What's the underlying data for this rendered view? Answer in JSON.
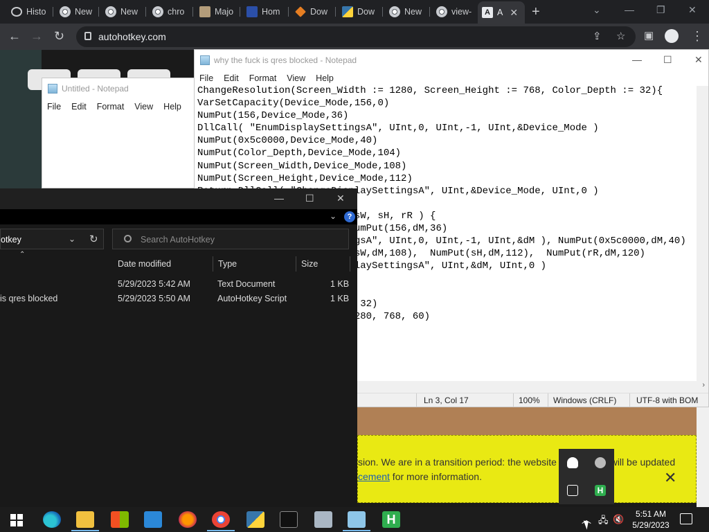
{
  "browser": {
    "tabs": [
      {
        "label": "Histo",
        "icon": "history-icon"
      },
      {
        "label": "New",
        "icon": "chrome-icon"
      },
      {
        "label": "New",
        "icon": "chrome-icon"
      },
      {
        "label": "chro",
        "icon": "chrome-icon"
      },
      {
        "label": "Majo",
        "icon": "site-icon"
      },
      {
        "label": "Hom",
        "icon": "site-icon"
      },
      {
        "label": "Dow",
        "icon": "site-icon"
      },
      {
        "label": "Dow",
        "icon": "python-icon"
      },
      {
        "label": "New",
        "icon": "chrome-icon"
      },
      {
        "label": "view-",
        "icon": "chrome-icon"
      },
      {
        "label": "A",
        "icon": "autohotkey-icon",
        "active": true
      }
    ],
    "url": "autohotkey.com"
  },
  "notepad_bg": {
    "title": "Untitled - Notepad",
    "menu": [
      "File",
      "Edit",
      "Format",
      "View",
      "Help"
    ]
  },
  "notepad_main": {
    "title": "why the fuck is qres blocked - Notepad",
    "menu": [
      "File",
      "Edit",
      "Format",
      "View",
      "Help"
    ],
    "lines": [
      "ChangeResolution(Screen_Width := 1280, Screen_Height := 768, Color_Depth := 32){",
      "VarSetCapacity(Device_Mode,156,0)",
      "NumPut(156,Device_Mode,36)",
      "DllCall( \"EnumDisplaySettingsA\", UInt,0, UInt,-1, UInt,&Device_Mode )",
      "NumPut(0x5c0000,Device_Mode,40)",
      "NumPut(Color_Depth,Device_Mode,104)",
      "NumPut(Screen_Width,Device_Mode,108)",
      "NumPut(Screen_Height,Device_Mode,112)",
      "Return DllCall( \"ChangeDisplaySettingsA\", UInt,&Device_Mode, UInt,0 )",
      "}",
      "ChangeDisplaySettings( cD, sW, sH, rR ) {",
      "VarSetCapacity(dM,156,0), NumPut(156,dM,36)",
      "DllCall( \"EnumDisplaySettingsA\", UInt,0, UInt,-1, UInt,&dM ), NumPut(0x5c0000,dM,40)",
      "NumPut(cD,dM,104),  NumPut(sW,dM,108),  NumPut(sH,dM,112),  NumPut(rR,dM,120)",
      "Return DllCall( \"ChangeDisplaySettingsA\", UInt,&dM, UInt,0 )",
      "}",
      "",
      "ChangeResolution(1280, 768, 32)",
      "ChangeDisplaySettings(32, 1280, 768, 60)"
    ],
    "status": {
      "position": "Ln 3, Col 17",
      "zoom": "100%",
      "line_ending": "Windows (CRLF)",
      "encoding": "UTF-8 with BOM"
    }
  },
  "explorer": {
    "address_tail": "otkey",
    "search_placeholder": "Search AutoHotkey",
    "columns": [
      "Date modified",
      "Type",
      "Size"
    ],
    "rows": [
      {
        "name": "",
        "date": "5/29/2023 5:42 AM",
        "type": "Text Document",
        "size": "1 KB"
      },
      {
        "name": "is qres blocked",
        "date": "5/29/2023 5:50 AM",
        "type": "AutoHotkey Script",
        "size": "1 KB"
      }
    ]
  },
  "banner": {
    "line1": "sion. We are in a transition period: the website and forums will be updated",
    "line2_link": "cement",
    "line2_rest": " for more information."
  },
  "taskbar": {
    "time": "5:51 AM",
    "date": "5/29/2023"
  },
  "colors": {
    "chrome_dark": "#202124",
    "banner_yellow": "#e9e913",
    "taskbar": "#1c1c1c",
    "explorer_bg": "#191919"
  }
}
